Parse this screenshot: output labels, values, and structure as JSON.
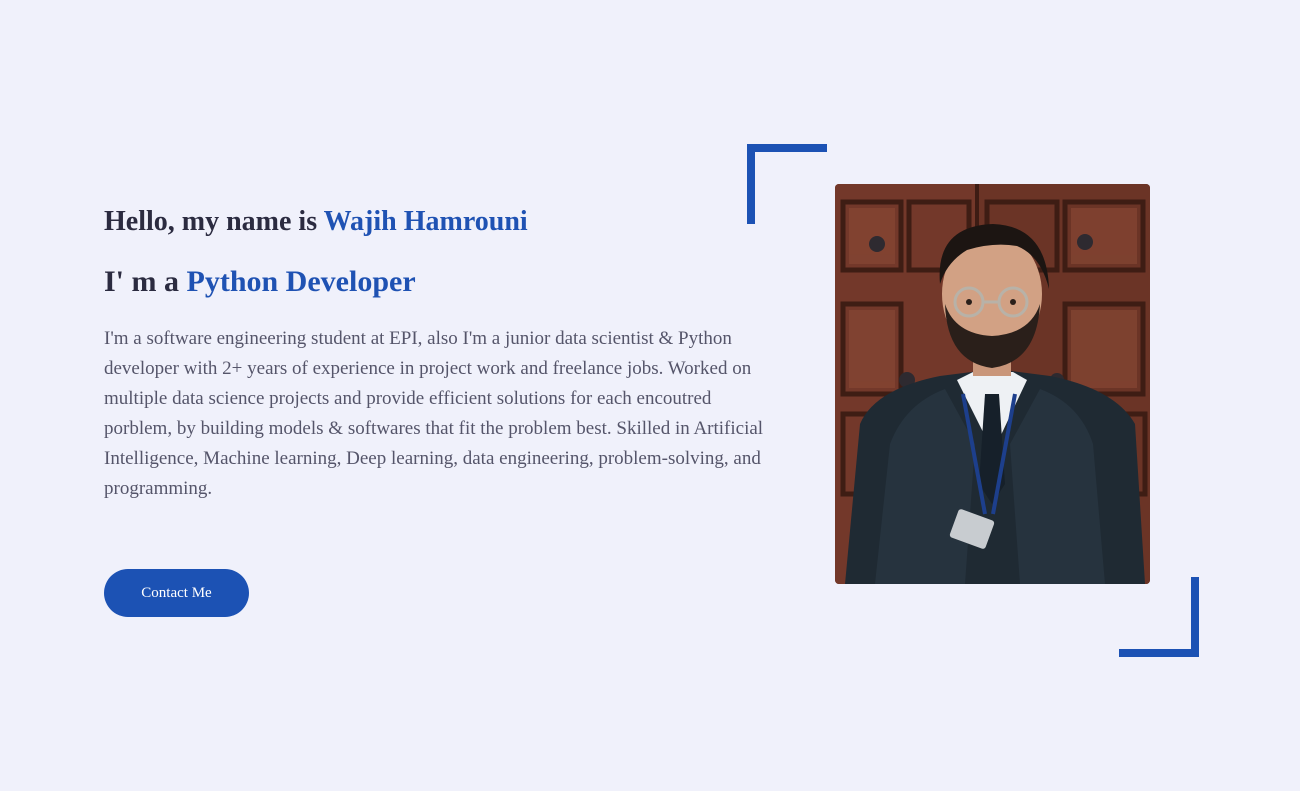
{
  "hero": {
    "greeting_prefix": "Hello, my name is ",
    "name": "Wajih Hamrouni",
    "role_prefix": "I' m a ",
    "role": "Python Developer",
    "bio": "I'm a software engineering student at EPI, also I'm a junior data scientist & Python developer with 2+ years of experience in project work and freelance jobs. Worked on multiple data science projects and provide efficient solutions for each encoutred porblem, by building models & softwares that fit the problem best. Skilled in Artificial Intelligence, Machine learning, Deep learning, data engineering, problem-solving, and programming.",
    "contact_button": "Contact Me"
  },
  "photo": {
    "subject": "profile-photo"
  },
  "colors": {
    "background": "#f0f1fb",
    "accent": "#1f52b3",
    "heading": "#2b2b40",
    "body_text": "#55556a"
  }
}
